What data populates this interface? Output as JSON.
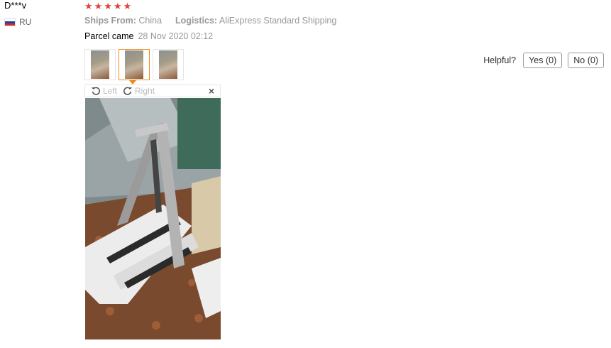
{
  "review": {
    "user_name": "D***v",
    "country_code": "RU",
    "flag_colors": [
      "#ffffff",
      "#1c3fa8",
      "#d52b1e"
    ],
    "rating": 5,
    "stars": [
      "★",
      "★",
      "★",
      "★",
      "★"
    ],
    "ships_from_label": "Ships From:",
    "ships_from_value": "China",
    "logistics_label": "Logistics:",
    "logistics_value": "AliExpress Standard Shipping",
    "parcel_label": "Parcel came",
    "parcel_date": "28 Nov 2020 02:12",
    "thumbnail_count": 3,
    "active_thumbnail_index": 1
  },
  "helpful": {
    "label": "Helpful?",
    "yes_label": "Yes (0)",
    "no_label": "No (0)"
  },
  "viewer": {
    "rotate_left_label": "Left",
    "rotate_right_label": "Right",
    "close_symbol": "×"
  },
  "colors": {
    "star": "#e0413a",
    "active_border": "#f08a1c",
    "muted_text": "#999999"
  }
}
